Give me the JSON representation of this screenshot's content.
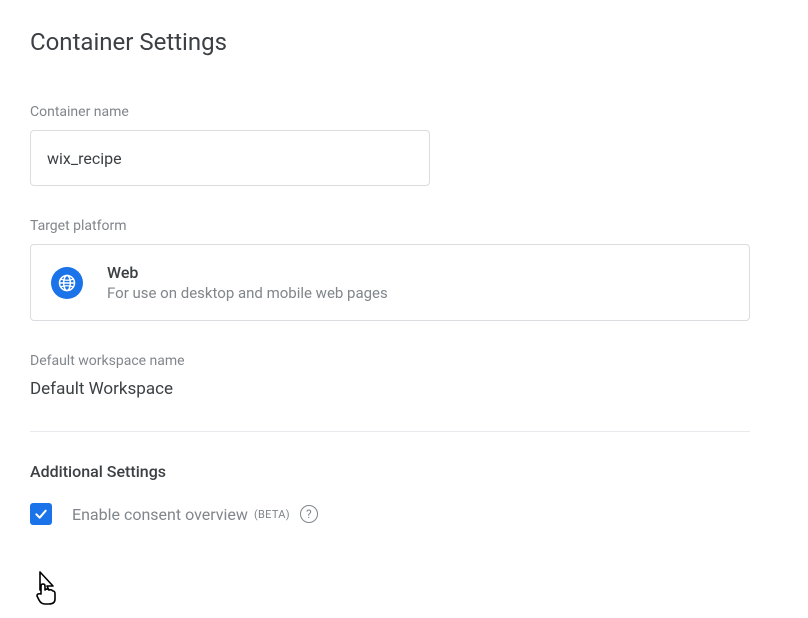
{
  "title": "Container Settings",
  "container_name": {
    "label": "Container name",
    "value": "wix_recipe"
  },
  "target_platform": {
    "label": "Target platform",
    "name": "Web",
    "description": "For use on desktop and mobile web pages"
  },
  "default_workspace": {
    "label": "Default workspace name",
    "value": "Default Workspace"
  },
  "additional_settings": {
    "heading": "Additional Settings",
    "consent_overview": {
      "label": "Enable consent overview",
      "badge": "(BETA)",
      "checked": true
    }
  },
  "colors": {
    "accent": "#1a73e8"
  }
}
